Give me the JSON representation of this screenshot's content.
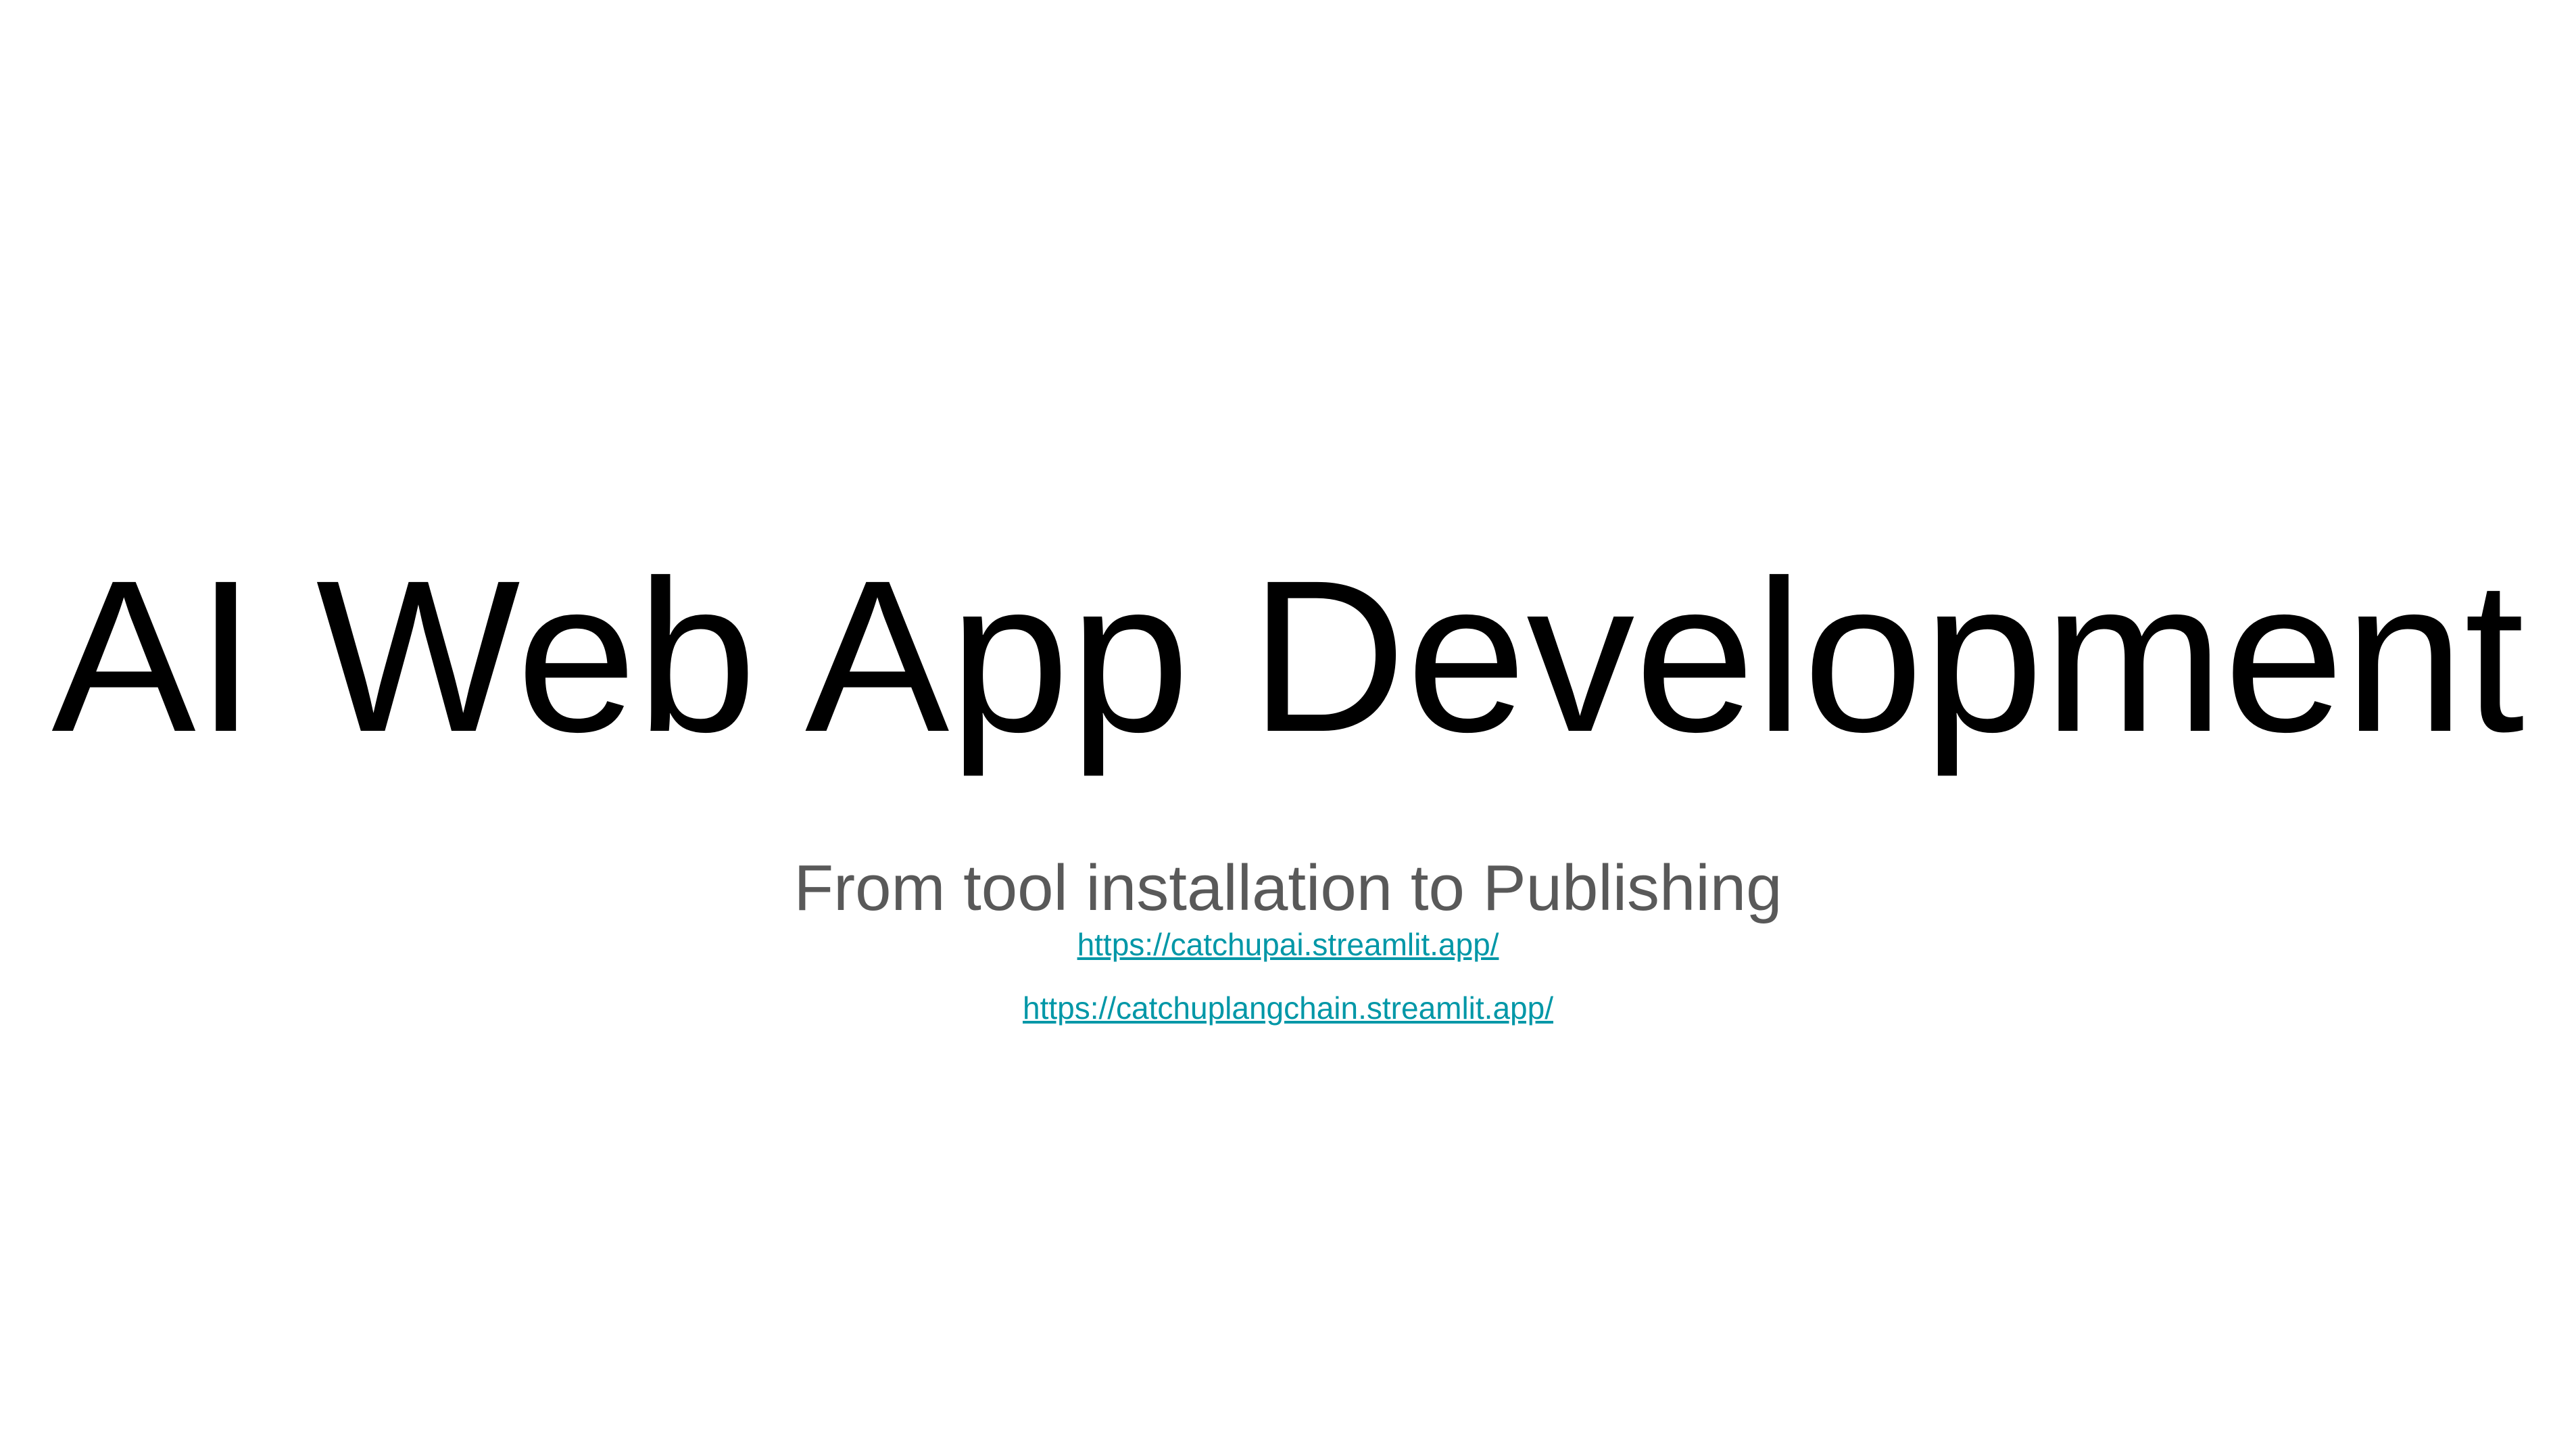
{
  "slide": {
    "title": "AI Web App Development",
    "subtitle": "From tool installation to Publishing",
    "links": [
      {
        "text": "https://catchupai.streamlit.app/"
      },
      {
        "text": "https://catchuplangchain.streamlit.app/"
      }
    ]
  },
  "colors": {
    "background": "#ffffff",
    "title": "#000000",
    "subtitle": "#595959",
    "link": "#0097a7"
  }
}
